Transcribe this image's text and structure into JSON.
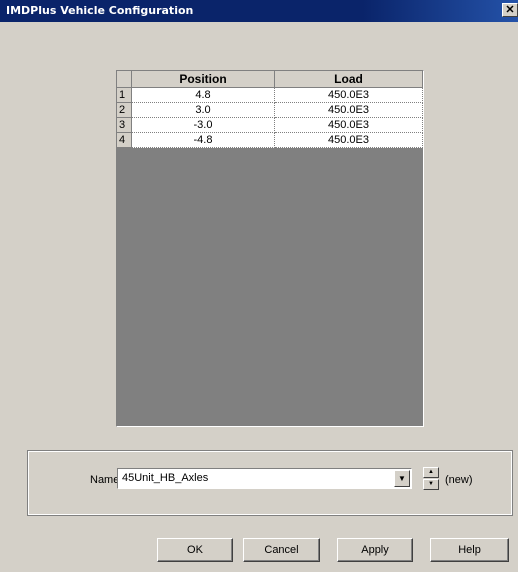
{
  "window": {
    "title": "IMDPlus Vehicle Configuration",
    "close_glyph": "✕"
  },
  "grid": {
    "columns": [
      "Position",
      "Load"
    ],
    "rows": [
      {
        "num": "1",
        "position": "4.8",
        "load": "450.0E3"
      },
      {
        "num": "2",
        "position": "3.0",
        "load": "450.0E3"
      },
      {
        "num": "3",
        "position": "-3.0",
        "load": "450.0E3"
      },
      {
        "num": "4",
        "position": "-4.8",
        "load": "450.0E3"
      }
    ]
  },
  "name_field": {
    "label": "Name",
    "value": "45Unit_HB_Axles",
    "dropdown_icon": "chevron-down-icon",
    "spinner_icon": "up-down-spinner-icon",
    "status": "(new)"
  },
  "buttons": {
    "ok": "OK",
    "cancel": "Cancel",
    "apply": "Apply",
    "help": "Help"
  }
}
